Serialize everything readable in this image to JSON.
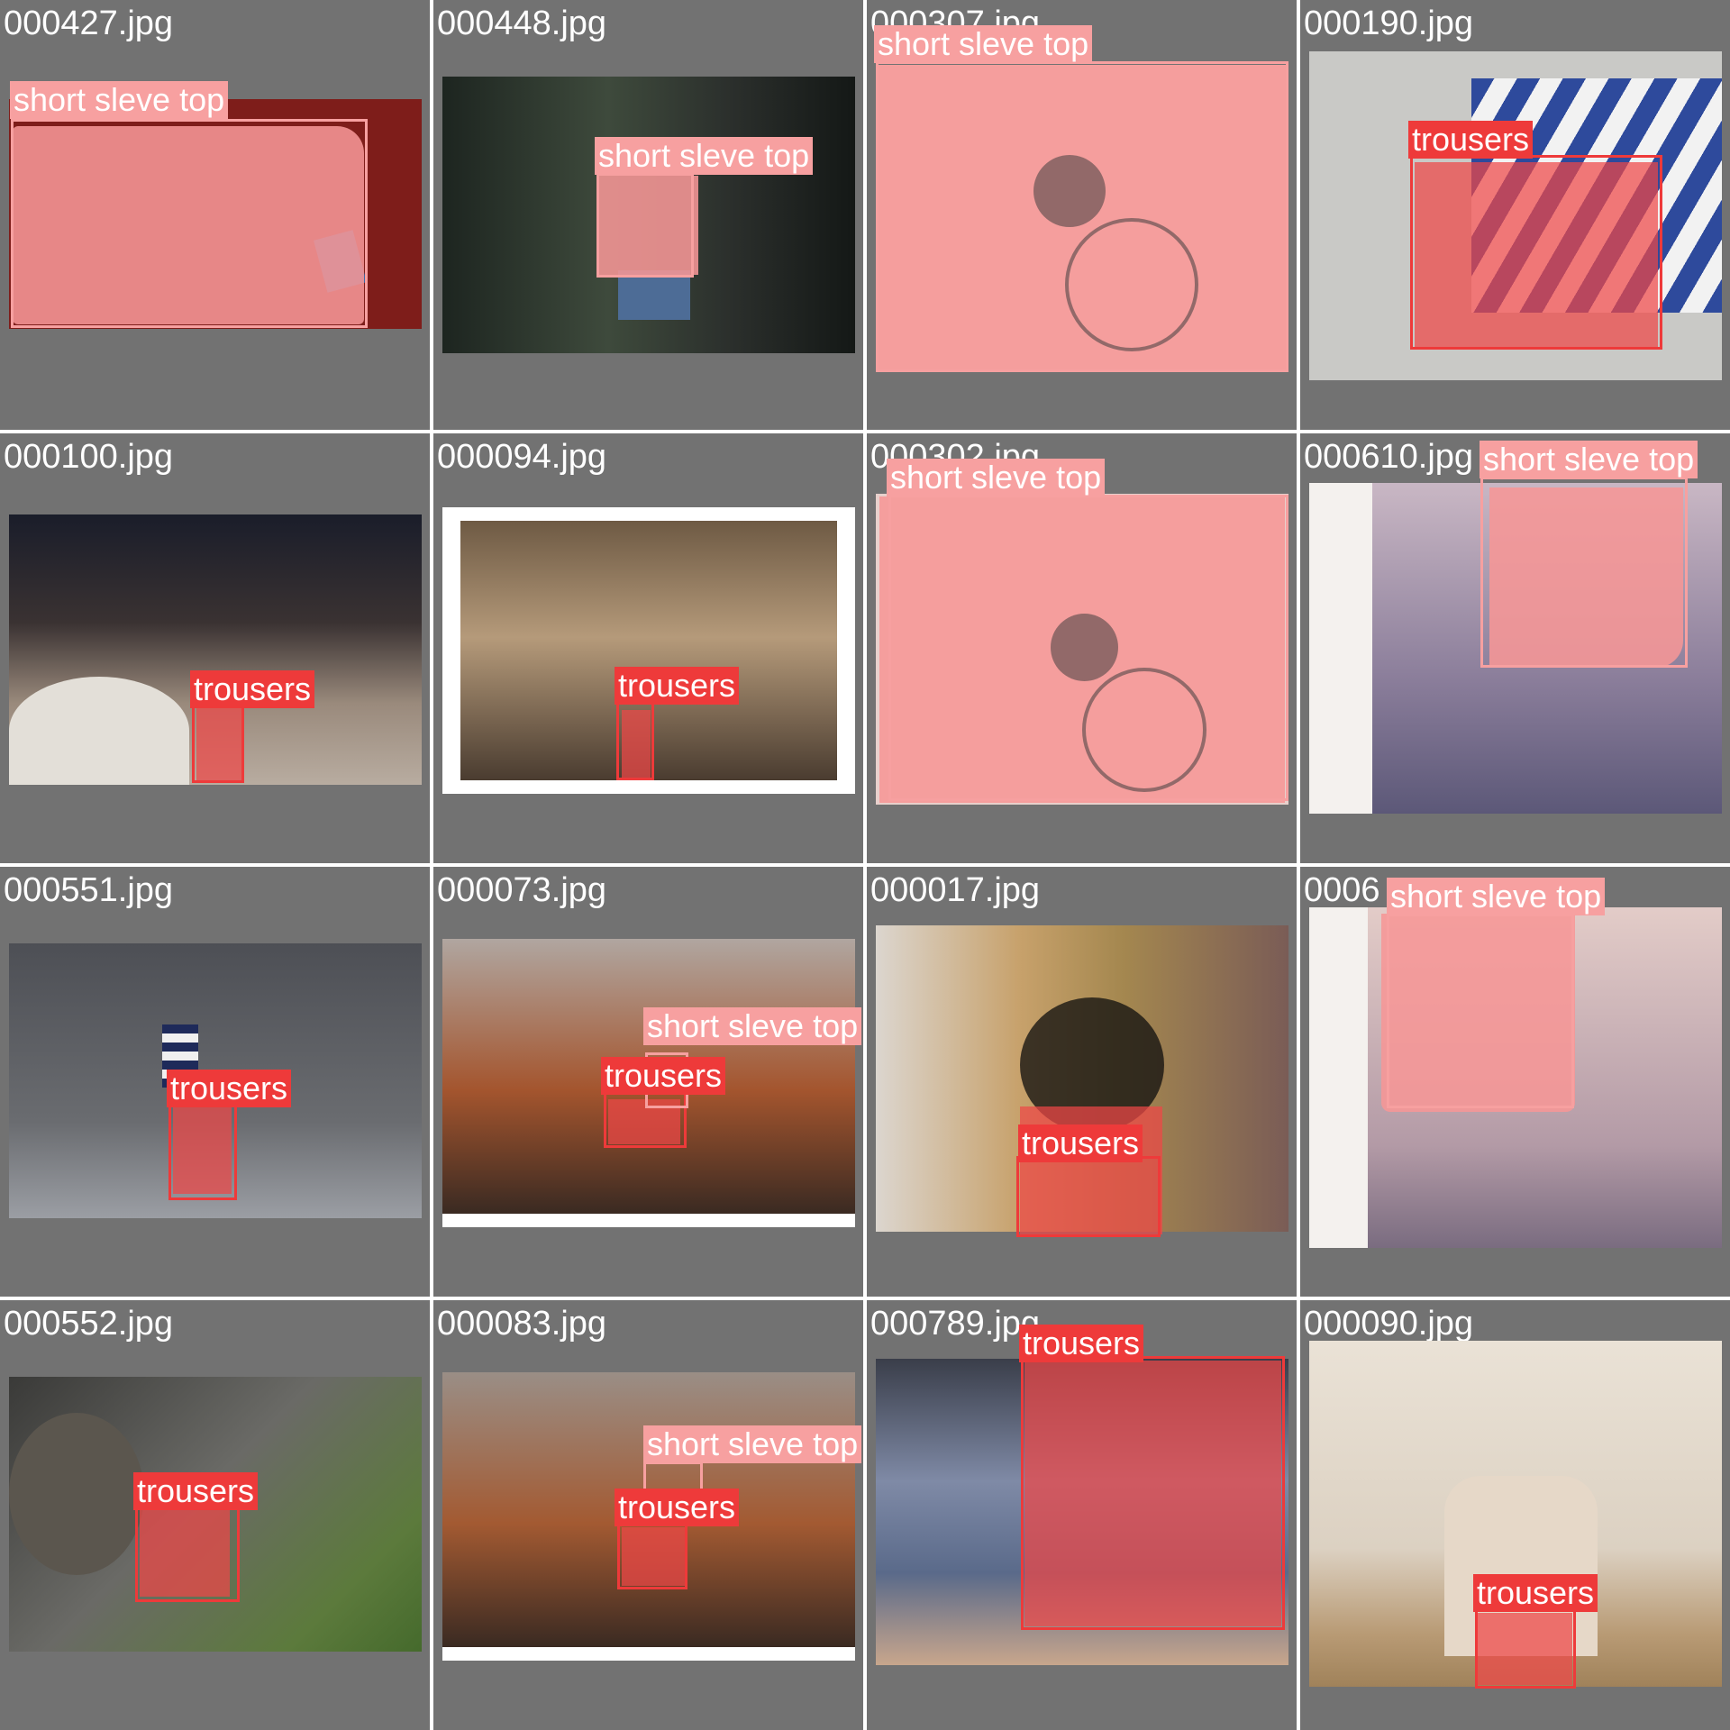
{
  "tiles": [
    {
      "filename": "000427.jpg",
      "labels": [
        "short sleve top"
      ]
    },
    {
      "filename": "000448.jpg",
      "labels": [
        "short sleve top"
      ]
    },
    {
      "filename": "000307.jpg",
      "labels": [
        "short sleve top"
      ]
    },
    {
      "filename": "000190.jpg",
      "labels": [
        "trousers"
      ]
    },
    {
      "filename": "000100.jpg",
      "labels": [
        "trousers"
      ]
    },
    {
      "filename": "000094.jpg",
      "labels": [
        "trousers"
      ]
    },
    {
      "filename": "000302.jpg",
      "labels": [
        "short sleve top"
      ]
    },
    {
      "filename": "000610.jpg",
      "labels": [
        "short sleve top"
      ]
    },
    {
      "filename": "000551.jpg",
      "labels": [
        "trousers"
      ]
    },
    {
      "filename": "000073.jpg",
      "labels": [
        "short sleve top",
        "trousers"
      ]
    },
    {
      "filename": "000017.jpg",
      "labels": [
        "trousers"
      ]
    },
    {
      "filename": "0006",
      "labels": [
        "short sleve top"
      ]
    },
    {
      "filename": "000552.jpg",
      "labels": [
        "trousers"
      ]
    },
    {
      "filename": "000083.jpg",
      "labels": [
        "short sleve top",
        "trousers"
      ]
    },
    {
      "filename": "000789.jpg",
      "labels": [
        "trousers"
      ]
    },
    {
      "filename": "000090.jpg",
      "labels": [
        "trousers"
      ]
    }
  ],
  "colors": {
    "tile_background": "#727272",
    "short_sleve_top": "#f7a0a0",
    "trousers": "#ee3a3a"
  }
}
